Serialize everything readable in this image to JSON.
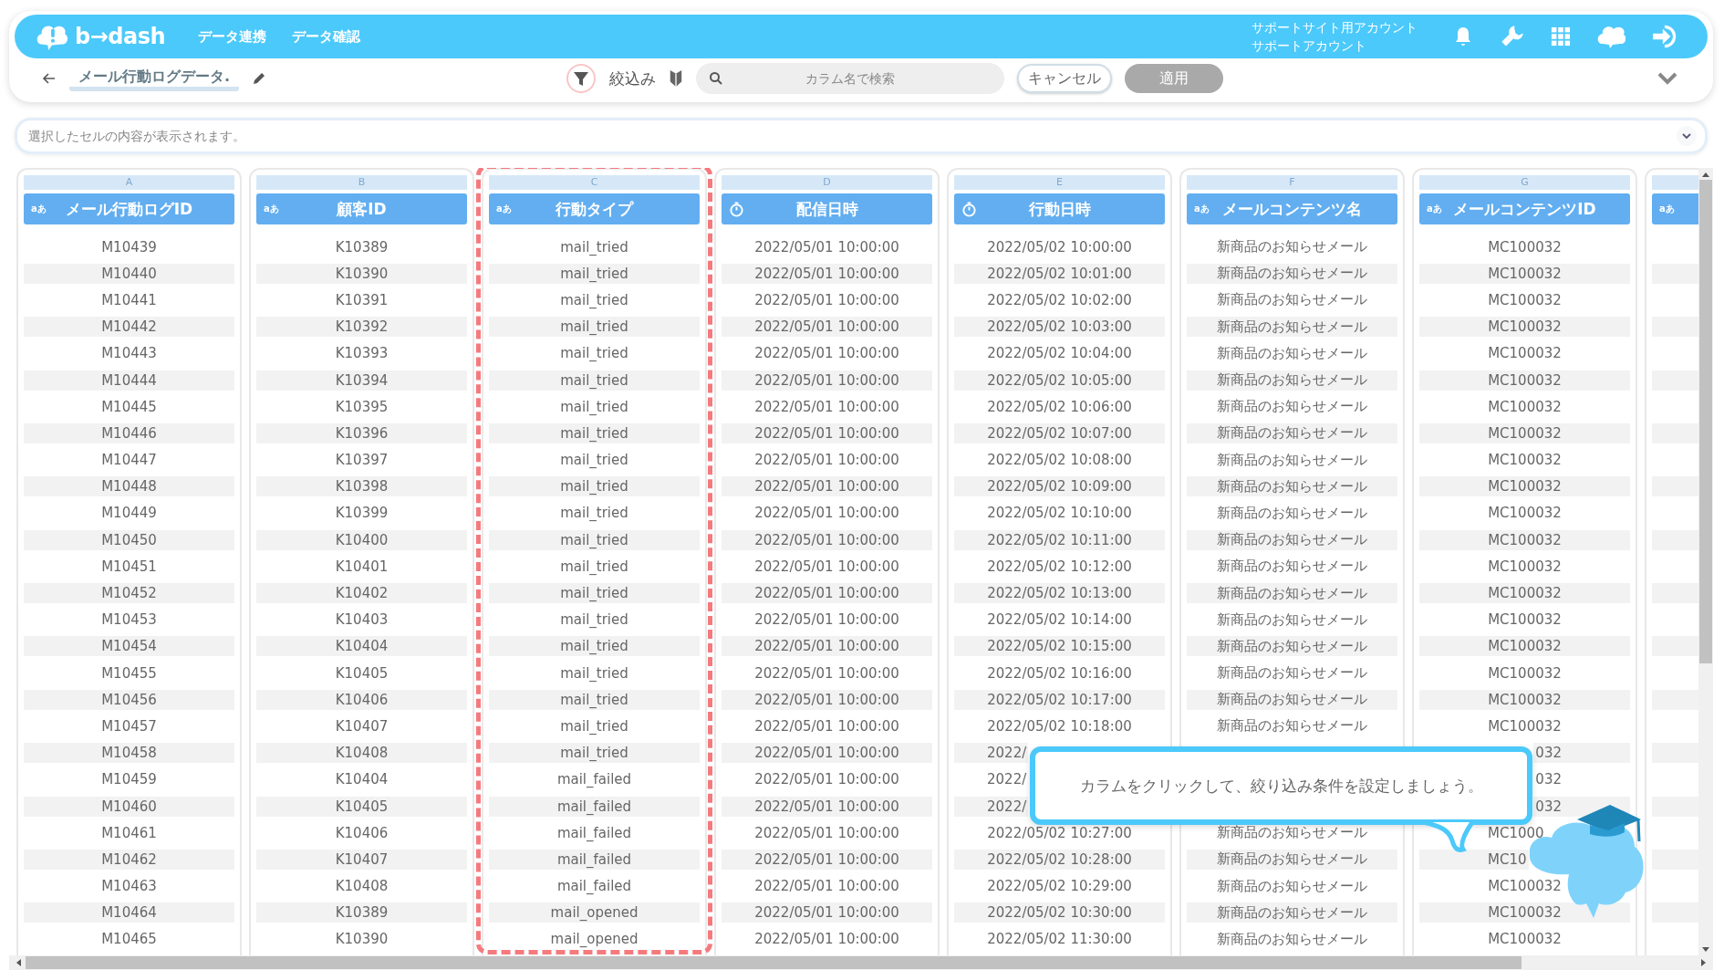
{
  "header": {
    "logo": "b→dash",
    "nav": [
      "データ連携",
      "データ確認"
    ],
    "account": [
      "サポートサイト用アカウント",
      "サポートアカウント"
    ]
  },
  "toolbar": {
    "title": "メール行動ログデータ.",
    "filter_label": "絞込み",
    "search": {
      "placeholder": "カラム名で検索"
    },
    "cancel": "キャンセル",
    "apply": {
      "label": "適用",
      "disabled": true
    }
  },
  "cell_viewer": {
    "placeholder": "選択したセルの内容が表示されます。"
  },
  "table": {
    "columns": [
      {
        "letter": "A",
        "kind": "text",
        "badge": "aあ",
        "name": "メール行動ログID",
        "highlighted": false
      },
      {
        "letter": "B",
        "kind": "text",
        "badge": "aあ",
        "name": "顧客ID",
        "highlighted": false
      },
      {
        "letter": "C",
        "kind": "text",
        "badge": "aあ",
        "name": "行動タイプ",
        "highlighted": true
      },
      {
        "letter": "D",
        "kind": "datetime",
        "name": "配信日時",
        "highlighted": false
      },
      {
        "letter": "E",
        "kind": "datetime",
        "name": "行動日時",
        "highlighted": false
      },
      {
        "letter": "F",
        "kind": "text",
        "badge": "aあ",
        "name": "メールコンテンツ名",
        "highlighted": false
      },
      {
        "letter": "G",
        "kind": "text",
        "badge": "aあ",
        "name": "メールコンテンツID",
        "highlighted": false
      },
      {
        "kind": "text",
        "badge": "aあ",
        "highlighted": false
      }
    ],
    "rows": [
      [
        "M10439",
        "K10389",
        "mail_tried",
        "2022/05/01 10:00:00",
        "2022/05/02 10:00:00",
        "新商品のお知らせメール",
        "MC100032"
      ],
      [
        "M10440",
        "K10390",
        "mail_tried",
        "2022/05/01 10:00:00",
        "2022/05/02 10:01:00",
        "新商品のお知らせメール",
        "MC100032"
      ],
      [
        "M10441",
        "K10391",
        "mail_tried",
        "2022/05/01 10:00:00",
        "2022/05/02 10:02:00",
        "新商品のお知らせメール",
        "MC100032"
      ],
      [
        "M10442",
        "K10392",
        "mail_tried",
        "2022/05/01 10:00:00",
        "2022/05/02 10:03:00",
        "新商品のお知らせメール",
        "MC100032"
      ],
      [
        "M10443",
        "K10393",
        "mail_tried",
        "2022/05/01 10:00:00",
        "2022/05/02 10:04:00",
        "新商品のお知らせメール",
        "MC100032"
      ],
      [
        "M10444",
        "K10394",
        "mail_tried",
        "2022/05/01 10:00:00",
        "2022/05/02 10:05:00",
        "新商品のお知らせメール",
        "MC100032"
      ],
      [
        "M10445",
        "K10395",
        "mail_tried",
        "2022/05/01 10:00:00",
        "2022/05/02 10:06:00",
        "新商品のお知らせメール",
        "MC100032"
      ],
      [
        "M10446",
        "K10396",
        "mail_tried",
        "2022/05/01 10:00:00",
        "2022/05/02 10:07:00",
        "新商品のお知らせメール",
        "MC100032"
      ],
      [
        "M10447",
        "K10397",
        "mail_tried",
        "2022/05/01 10:00:00",
        "2022/05/02 10:08:00",
        "新商品のお知らせメール",
        "MC100032"
      ],
      [
        "M10448",
        "K10398",
        "mail_tried",
        "2022/05/01 10:00:00",
        "2022/05/02 10:09:00",
        "新商品のお知らせメール",
        "MC100032"
      ],
      [
        "M10449",
        "K10399",
        "mail_tried",
        "2022/05/01 10:00:00",
        "2022/05/02 10:10:00",
        "新商品のお知らせメール",
        "MC100032"
      ],
      [
        "M10450",
        "K10400",
        "mail_tried",
        "2022/05/01 10:00:00",
        "2022/05/02 10:11:00",
        "新商品のお知らせメール",
        "MC100032"
      ],
      [
        "M10451",
        "K10401",
        "mail_tried",
        "2022/05/01 10:00:00",
        "2022/05/02 10:12:00",
        "新商品のお知らせメール",
        "MC100032"
      ],
      [
        "M10452",
        "K10402",
        "mail_tried",
        "2022/05/01 10:00:00",
        "2022/05/02 10:13:00",
        "新商品のお知らせメール",
        "MC100032"
      ],
      [
        "M10453",
        "K10403",
        "mail_tried",
        "2022/05/01 10:00:00",
        "2022/05/02 10:14:00",
        "新商品のお知らせメール",
        "MC100032"
      ],
      [
        "M10454",
        "K10404",
        "mail_tried",
        "2022/05/01 10:00:00",
        "2022/05/02 10:15:00",
        "新商品のお知らせメール",
        "MC100032"
      ],
      [
        "M10455",
        "K10405",
        "mail_tried",
        "2022/05/01 10:00:00",
        "2022/05/02 10:16:00",
        "新商品のお知らせメール",
        "MC100032"
      ],
      [
        "M10456",
        "K10406",
        "mail_tried",
        "2022/05/01 10:00:00",
        "2022/05/02 10:17:00",
        "新商品のお知らせメール",
        "MC100032"
      ],
      [
        "M10457",
        "K10407",
        "mail_tried",
        "2022/05/01 10:00:00",
        "2022/05/02 10:18:00",
        "新商品のお知らせメール",
        "MC100032"
      ],
      [
        "M10458",
        "K10408",
        "mail_tried",
        "2022/05/01 10:00:00",
        {
          "text": "2022/",
          "kind": "cut_start"
        },
        null,
        {
          "text": "032",
          "kind": "cut_end"
        }
      ],
      [
        "M10459",
        "K10404",
        "mail_failed",
        "2022/05/01 10:00:00",
        {
          "text": "2022/",
          "kind": "cut_start"
        },
        null,
        {
          "text": "032",
          "kind": "cut_end"
        }
      ],
      [
        "M10460",
        "K10405",
        "mail_failed",
        "2022/05/01 10:00:00",
        {
          "text": "2022/",
          "kind": "cut_start"
        },
        null,
        {
          "text": "032",
          "kind": "cut_end"
        }
      ],
      [
        "M10461",
        "K10406",
        "mail_failed",
        "2022/05/01 10:00:00",
        "2022/05/02 10:27:00",
        "新商品のお知らせメール",
        {
          "text": "MC1000",
          "kind": "cut_start"
        }
      ],
      [
        "M10462",
        "K10407",
        "mail_failed",
        "2022/05/01 10:00:00",
        "2022/05/02 10:28:00",
        "新商品のお知らせメール",
        {
          "text": "MC10",
          "kind": "cut_start"
        }
      ],
      [
        "M10463",
        "K10408",
        "mail_failed",
        "2022/05/01 10:00:00",
        "2022/05/02 10:29:00",
        "新商品のお知らせメール",
        "MC100032"
      ],
      [
        "M10464",
        "K10389",
        "mail_opened",
        "2022/05/01 10:00:00",
        "2022/05/02 10:30:00",
        "新商品のお知らせメール",
        "MC100032"
      ],
      [
        "M10465",
        "K10390",
        "mail_opened",
        "2022/05/01 10:00:00",
        "2022/05/02 11:30:00",
        "新商品のお知らせメール",
        "MC100032"
      ]
    ]
  },
  "tooltip": {
    "text": "カラムをクリックして、絞り込み条件を設定しましょう。"
  }
}
